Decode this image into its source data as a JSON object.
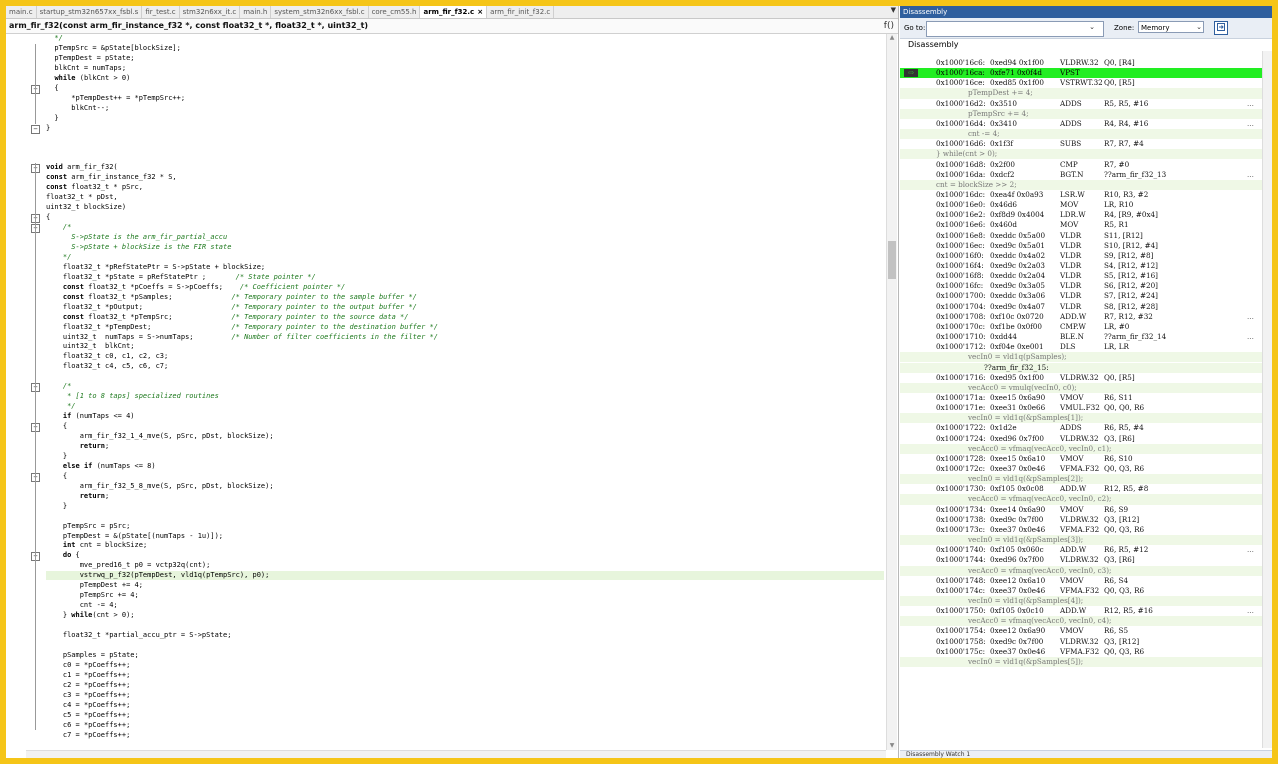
{
  "editor": {
    "tabs": [
      {
        "label": "main.c",
        "active": false
      },
      {
        "label": "startup_stm32n657xx_fsbl.s",
        "active": false
      },
      {
        "label": "fir_test.c",
        "active": false
      },
      {
        "label": "stm32n6xx_it.c",
        "active": false
      },
      {
        "label": "main.h",
        "active": false
      },
      {
        "label": "system_stm32n6xx_fsbl.c",
        "active": false
      },
      {
        "label": "core_cm55.h",
        "active": false
      },
      {
        "label": "arm_fir_f32.c",
        "active": true
      },
      {
        "label": "arm_fir_init_f32.c",
        "active": false
      }
    ],
    "tab_close_glyph": "×",
    "tab_list_glyph": "▼",
    "function_signature": "arm_fir_f32(const arm_fir_instance_f32 *, const float32_t *, float32_t *, uint32_t)",
    "function_icon": "f()",
    "lines": [
      {
        "text": "  */",
        "type": "comment"
      },
      {
        "text": "  pTempSrc = &pState[blockSize];",
        "type": "code"
      },
      {
        "text": "  pTempDest = pState;",
        "type": "code"
      },
      {
        "text": "  blkCnt = numTaps;",
        "type": "code"
      },
      {
        "text": "  while (blkCnt > 0)",
        "type": "code"
      },
      {
        "text": "  {",
        "type": "code"
      },
      {
        "text": "      *pTempDest++ = *pTempSrc++;",
        "type": "code"
      },
      {
        "text": "      blkCnt--;",
        "type": "code"
      },
      {
        "text": "  }",
        "type": "code"
      },
      {
        "text": "}",
        "type": "code"
      },
      {
        "text": "",
        "type": "code"
      },
      {
        "text": "",
        "type": "code"
      },
      {
        "text": "",
        "type": "code"
      },
      {
        "text": "void arm_fir_f32(",
        "type": "code"
      },
      {
        "text": "const arm_fir_instance_f32 * S,",
        "type": "code"
      },
      {
        "text": "const float32_t * pSrc,",
        "type": "code"
      },
      {
        "text": "float32_t * pDst,",
        "type": "code"
      },
      {
        "text": "uint32_t blockSize)",
        "type": "code"
      },
      {
        "text": "{",
        "type": "code"
      },
      {
        "text": "    /*",
        "type": "comment"
      },
      {
        "text": "      S->pState is the arm_fir_partial_accu",
        "type": "comment"
      },
      {
        "text": "      S->pState + blockSize is the FIR state",
        "type": "comment"
      },
      {
        "text": "    */",
        "type": "comment"
      },
      {
        "text": "    float32_t *pRefStatePtr = S->pState + blockSize;",
        "type": "code"
      },
      {
        "text": "    float32_t *pState = pRefStatePtr ;       /* State pointer */",
        "type": "code"
      },
      {
        "text": "    const float32_t *pCoeffs = S->pCoeffs;    /* Coefficient pointer */",
        "type": "code"
      },
      {
        "text": "    const float32_t *pSamples;              /* Temporary pointer to the sample buffer */",
        "type": "code"
      },
      {
        "text": "    float32_t *pOutput;                     /* Temporary pointer to the output buffer */",
        "type": "code"
      },
      {
        "text": "    const float32_t *pTempSrc;              /* Temporary pointer to the source data */",
        "type": "code"
      },
      {
        "text": "    float32_t *pTempDest;                   /* Temporary pointer to the destination buffer */",
        "type": "code"
      },
      {
        "text": "    uint32_t  numTaps = S->numTaps;         /* Number of filter coefficients in the filter */",
        "type": "code"
      },
      {
        "text": "    uint32_t  blkCnt;",
        "type": "code"
      },
      {
        "text": "    float32_t c0, c1, c2, c3;",
        "type": "code"
      },
      {
        "text": "    float32_t c4, c5, c6, c7;",
        "type": "code"
      },
      {
        "text": "",
        "type": "code"
      },
      {
        "text": "    /*",
        "type": "comment"
      },
      {
        "text": "     * [1 to 8 taps] specialized routines",
        "type": "comment"
      },
      {
        "text": "     */",
        "type": "comment"
      },
      {
        "text": "    if (numTaps <= 4)",
        "type": "code"
      },
      {
        "text": "    {",
        "type": "code"
      },
      {
        "text": "        arm_fir_f32_1_4_mve(S, pSrc, pDst, blockSize);",
        "type": "code"
      },
      {
        "text": "        return;",
        "type": "code"
      },
      {
        "text": "    }",
        "type": "code"
      },
      {
        "text": "    else if (numTaps <= 8)",
        "type": "code"
      },
      {
        "text": "    {",
        "type": "code"
      },
      {
        "text": "        arm_fir_f32_5_8_mve(S, pSrc, pDst, blockSize);",
        "type": "code"
      },
      {
        "text": "        return;",
        "type": "code"
      },
      {
        "text": "    }",
        "type": "code"
      },
      {
        "text": "",
        "type": "code"
      },
      {
        "text": "    pTempSrc = pSrc;",
        "type": "code"
      },
      {
        "text": "    pTempDest = &(pState[(numTaps - 1u)]);",
        "type": "code"
      },
      {
        "text": "    int cnt = blockSize;",
        "type": "code"
      },
      {
        "text": "    do {",
        "type": "code"
      },
      {
        "text": "        mve_pred16_t p0 = vctp32q(cnt);",
        "type": "code"
      },
      {
        "text": "        vstrwq_p_f32(pTempDest, vld1q(pTempSrc), p0);",
        "type": "current"
      },
      {
        "text": "        pTempDest += 4;",
        "type": "code"
      },
      {
        "text": "        pTempSrc += 4;",
        "type": "code"
      },
      {
        "text": "        cnt -= 4;",
        "type": "code"
      },
      {
        "text": "    } while(cnt > 0);",
        "type": "code"
      },
      {
        "text": "",
        "type": "code"
      },
      {
        "text": "    float32_t *partial_accu_ptr = S->pState;",
        "type": "code"
      },
      {
        "text": "",
        "type": "code"
      },
      {
        "text": "    pSamples = pState;",
        "type": "code"
      },
      {
        "text": "    c0 = *pCoeffs++;",
        "type": "code"
      },
      {
        "text": "    c1 = *pCoeffs++;",
        "type": "code"
      },
      {
        "text": "    c2 = *pCoeffs++;",
        "type": "code"
      },
      {
        "text": "    c3 = *pCoeffs++;",
        "type": "code"
      },
      {
        "text": "    c4 = *pCoeffs++;",
        "type": "code"
      },
      {
        "text": "    c5 = *pCoeffs++;",
        "type": "code"
      },
      {
        "text": "    c6 = *pCoeffs++;",
        "type": "code"
      },
      {
        "text": "    c7 = *pCoeffs++;",
        "type": "code"
      }
    ],
    "folds": [
      {
        "line": 5,
        "glyph": "−"
      },
      {
        "line": 9,
        "glyph": "−"
      },
      {
        "line": 13,
        "glyph": "−"
      },
      {
        "line": 18,
        "glyph": "−"
      },
      {
        "line": 19,
        "glyph": "−"
      },
      {
        "line": 35,
        "glyph": "−"
      },
      {
        "line": 39,
        "glyph": "−"
      },
      {
        "line": 44,
        "glyph": "−"
      },
      {
        "line": 52,
        "glyph": "−"
      }
    ]
  },
  "disassembly": {
    "window_title": "Disassembly",
    "goto_label": "Go to:",
    "goto_value": "",
    "zone_label": "Zone:",
    "zone_value": "Memory",
    "header": "Disassembly",
    "current_marker": "⇨",
    "rows": [
      {
        "type": "asm",
        "addr": "0x1000'16c6:",
        "enc": "0xed94 0x1f00",
        "mn": "VLDRW.32",
        "ops": "Q0, [R4]"
      },
      {
        "type": "asm",
        "addr": "0x1000'16ca:",
        "enc": "0xfe71 0x0f4d",
        "mn": "VPST",
        "ops": "",
        "current": true
      },
      {
        "type": "asm",
        "addr": "0x1000'16ce:",
        "enc": "0xed85 0x1f00",
        "mn": "VSTRWT.32",
        "ops": "Q0, [R5]"
      },
      {
        "type": "src",
        "text": "pTempDest += 4;"
      },
      {
        "type": "asm",
        "addr": "0x1000'16d2:",
        "enc": "0x3510",
        "mn": "ADDS",
        "ops": "R5, R5, #16",
        "dots": true
      },
      {
        "type": "src",
        "text": "pTempSrc += 4;"
      },
      {
        "type": "asm",
        "addr": "0x1000'16d4:",
        "enc": "0x3410",
        "mn": "ADDS",
        "ops": "R4, R4, #16",
        "dots": true
      },
      {
        "type": "src",
        "text": "cnt -= 4;"
      },
      {
        "type": "asm",
        "addr": "0x1000'16d6:",
        "enc": "0x1f3f",
        "mn": "SUBS",
        "ops": "R7, R7, #4"
      },
      {
        "type": "src2",
        "text": "} while(cnt > 0);"
      },
      {
        "type": "asm",
        "addr": "0x1000'16d8:",
        "enc": "0x2f00",
        "mn": "CMP",
        "ops": "R7, #0"
      },
      {
        "type": "asm",
        "addr": "0x1000'16da:",
        "enc": "0xdcf2",
        "mn": "BGT.N",
        "ops": "??arm_fir_f32_13",
        "dots": true
      },
      {
        "type": "src2",
        "text": "cnt = blockSize >> 2;"
      },
      {
        "type": "asm",
        "addr": "0x1000'16dc:",
        "enc": "0xea4f 0x0a93",
        "mn": "LSR.W",
        "ops": "R10, R3, #2"
      },
      {
        "type": "asm",
        "addr": "0x1000'16e0:",
        "enc": "0x46d6",
        "mn": "MOV",
        "ops": "LR, R10"
      },
      {
        "type": "asm",
        "addr": "0x1000'16e2:",
        "enc": "0xf8d9 0x4004",
        "mn": "LDR.W",
        "ops": "R4, [R9, #0x4]"
      },
      {
        "type": "asm",
        "addr": "0x1000'16e6:",
        "enc": "0x460d",
        "mn": "MOV",
        "ops": "R5, R1"
      },
      {
        "type": "asm",
        "addr": "0x1000'16e8:",
        "enc": "0xeddc 0x5a00",
        "mn": "VLDR",
        "ops": "S11, [R12]"
      },
      {
        "type": "asm",
        "addr": "0x1000'16ec:",
        "enc": "0xed9c 0x5a01",
        "mn": "VLDR",
        "ops": "S10, [R12, #4]"
      },
      {
        "type": "asm",
        "addr": "0x1000'16f0:",
        "enc": "0xeddc 0x4a02",
        "mn": "VLDR",
        "ops": "S9, [R12, #8]"
      },
      {
        "type": "asm",
        "addr": "0x1000'16f4:",
        "enc": "0xed9c 0x2a03",
        "mn": "VLDR",
        "ops": "S4, [R12, #12]"
      },
      {
        "type": "asm",
        "addr": "0x1000'16f8:",
        "enc": "0xeddc 0x2a04",
        "mn": "VLDR",
        "ops": "S5, [R12, #16]"
      },
      {
        "type": "asm",
        "addr": "0x1000'16fc:",
        "enc": "0xed9c 0x3a05",
        "mn": "VLDR",
        "ops": "S6, [R12, #20]"
      },
      {
        "type": "asm",
        "addr": "0x1000'1700:",
        "enc": "0xeddc 0x3a06",
        "mn": "VLDR",
        "ops": "S7, [R12, #24]"
      },
      {
        "type": "asm",
        "addr": "0x1000'1704:",
        "enc": "0xed9c 0x4a07",
        "mn": "VLDR",
        "ops": "S8, [R12, #28]"
      },
      {
        "type": "asm",
        "addr": "0x1000'1708:",
        "enc": "0xf10c 0x0720",
        "mn": "ADD.W",
        "ops": "R7, R12, #32",
        "dots": true
      },
      {
        "type": "asm",
        "addr": "0x1000'170c:",
        "enc": "0xf1be 0x0f00",
        "mn": "CMP.W",
        "ops": "LR, #0"
      },
      {
        "type": "asm",
        "addr": "0x1000'1710:",
        "enc": "0xdd44",
        "mn": "BLE.N",
        "ops": "??arm_fir_f32_14",
        "dots": true
      },
      {
        "type": "asm",
        "addr": "0x1000'1712:",
        "enc": "0xf04e 0xe001",
        "mn": "DLS",
        "ops": "LR, LR"
      },
      {
        "type": "src",
        "text": "vecIn0 = vld1q(pSamples);"
      },
      {
        "type": "label",
        "text": "??arm_fir_f32_15:"
      },
      {
        "type": "asm",
        "addr": "0x1000'1716:",
        "enc": "0xed95 0x1f00",
        "mn": "VLDRW.32",
        "ops": "Q0, [R5]"
      },
      {
        "type": "src",
        "text": "vecAcc0 = vmulq(vecIn0, c0);"
      },
      {
        "type": "asm",
        "addr": "0x1000'171a:",
        "enc": "0xee15 0x6a90",
        "mn": "VMOV",
        "ops": "R6, S11"
      },
      {
        "type": "asm",
        "addr": "0x1000'171e:",
        "enc": "0xee31 0x0e66",
        "mn": "VMUL.F32",
        "ops": "Q0, Q0, R6"
      },
      {
        "type": "src",
        "text": "vecIn0 = vld1q(&pSamples[1]);"
      },
      {
        "type": "asm",
        "addr": "0x1000'1722:",
        "enc": "0x1d2e",
        "mn": "ADDS",
        "ops": "R6, R5, #4"
      },
      {
        "type": "asm",
        "addr": "0x1000'1724:",
        "enc": "0xed96 0x7f00",
        "mn": "VLDRW.32",
        "ops": "Q3, [R6]"
      },
      {
        "type": "src",
        "text": "vecAcc0 = vfmaq(vecAcc0, vecIn0, c1);"
      },
      {
        "type": "asm",
        "addr": "0x1000'1728:",
        "enc": "0xee15 0x6a10",
        "mn": "VMOV",
        "ops": "R6, S10"
      },
      {
        "type": "asm",
        "addr": "0x1000'172c:",
        "enc": "0xee37 0x0e46",
        "mn": "VFMA.F32",
        "ops": "Q0, Q3, R6"
      },
      {
        "type": "src",
        "text": "vecIn0 = vld1q(&pSamples[2]);"
      },
      {
        "type": "asm",
        "addr": "0x1000'1730:",
        "enc": "0xf105 0x0c08",
        "mn": "ADD.W",
        "ops": "R12, R5, #8"
      },
      {
        "type": "src",
        "text": "vecAcc0 = vfmaq(vecAcc0, vecIn0, c2);"
      },
      {
        "type": "asm",
        "addr": "0x1000'1734:",
        "enc": "0xee14 0x6a90",
        "mn": "VMOV",
        "ops": "R6, S9"
      },
      {
        "type": "asm",
        "addr": "0x1000'1738:",
        "enc": "0xed9c 0x7f00",
        "mn": "VLDRW.32",
        "ops": "Q3, [R12]"
      },
      {
        "type": "asm",
        "addr": "0x1000'173c:",
        "enc": "0xee37 0x0e46",
        "mn": "VFMA.F32",
        "ops": "Q0, Q3, R6"
      },
      {
        "type": "src",
        "text": "vecIn0 = vld1q(&pSamples[3]);"
      },
      {
        "type": "asm",
        "addr": "0x1000'1740:",
        "enc": "0xf105 0x060c",
        "mn": "ADD.W",
        "ops": "R6, R5, #12",
        "dots": true
      },
      {
        "type": "asm",
        "addr": "0x1000'1744:",
        "enc": "0xed96 0x7f00",
        "mn": "VLDRW.32",
        "ops": "Q3, [R6]"
      },
      {
        "type": "src",
        "text": "vecAcc0 = vfmaq(vecAcc0, vecIn0, c3);"
      },
      {
        "type": "asm",
        "addr": "0x1000'1748:",
        "enc": "0xee12 0x6a10",
        "mn": "VMOV",
        "ops": "R6, S4"
      },
      {
        "type": "asm",
        "addr": "0x1000'174c:",
        "enc": "0xee37 0x0e46",
        "mn": "VFMA.F32",
        "ops": "Q0, Q3, R6"
      },
      {
        "type": "src",
        "text": "vecIn0 = vld1q(&pSamples[4]);"
      },
      {
        "type": "asm",
        "addr": "0x1000'1750:",
        "enc": "0xf105 0x0c10",
        "mn": "ADD.W",
        "ops": "R12, R5, #16",
        "dots": true
      },
      {
        "type": "src",
        "text": "vecAcc0 = vfmaq(vecAcc0, vecIn0, c4);"
      },
      {
        "type": "asm",
        "addr": "0x1000'1754:",
        "enc": "0xee12 0x6a90",
        "mn": "VMOV",
        "ops": "R6, S5"
      },
      {
        "type": "asm",
        "addr": "0x1000'1758:",
        "enc": "0xed9c 0x7f00",
        "mn": "VLDRW.32",
        "ops": "Q3, [R12]"
      },
      {
        "type": "asm",
        "addr": "0x1000'175c:",
        "enc": "0xee37 0x0e46",
        "mn": "VFMA.F32",
        "ops": "Q0, Q3, R6"
      },
      {
        "type": "src",
        "text": "vecIn0 = vld1q(&pSamples[5]);"
      }
    ],
    "bottom_tabs": "Disassembly  Watch 1"
  }
}
